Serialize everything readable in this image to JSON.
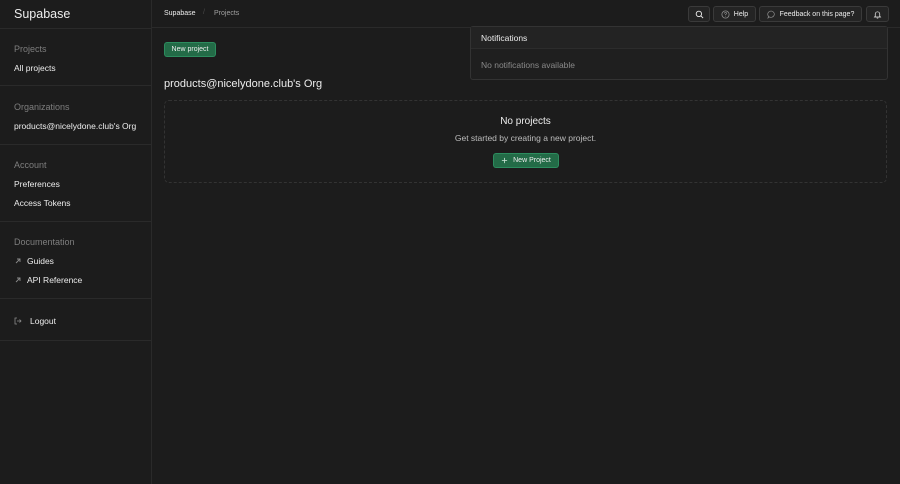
{
  "app": {
    "brand": "Supabase"
  },
  "breadcrumb": {
    "org": "Supabase",
    "page": "Projects",
    "separator": "/"
  },
  "topbar": {
    "help_label": "Help",
    "feedback_label": "Feedback on this page?"
  },
  "sidebar": {
    "projects_title": "Projects",
    "all_projects": "All projects",
    "organizations_title": "Organizations",
    "org_name": "products@nicelydone.club's Org",
    "account_title": "Account",
    "preferences": "Preferences",
    "access_tokens": "Access Tokens",
    "documentation_title": "Documentation",
    "guides": "Guides",
    "api_reference": "API Reference",
    "logout": "Logout"
  },
  "main": {
    "new_project_button": "New project",
    "org_title": "products@nicelydone.club's Org",
    "empty_title": "No projects",
    "empty_subtitle": "Get started by creating a new project.",
    "empty_button": "New Project"
  },
  "notifications": {
    "title": "Notifications",
    "empty": "No notifications available"
  },
  "colors": {
    "accent": "#3ecf8e",
    "button_green": "#236b47",
    "background": "#1c1c1c"
  }
}
